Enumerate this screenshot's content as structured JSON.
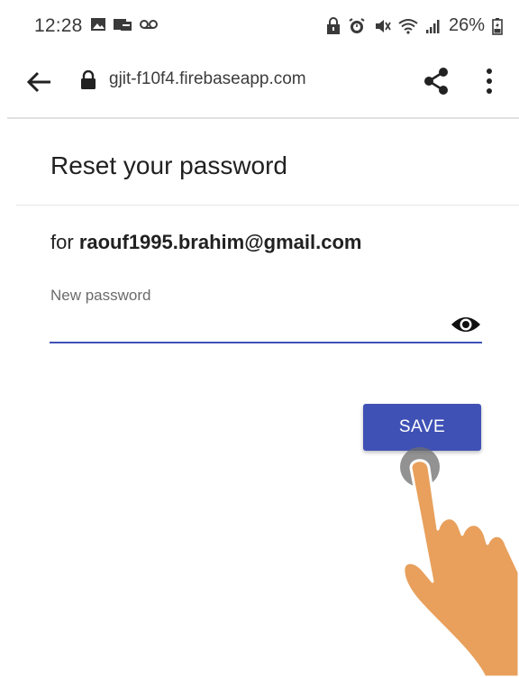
{
  "status_bar": {
    "time": "12:28",
    "battery_percent": "26%",
    "left_icons": [
      "image-icon",
      "sim-icon",
      "voicemail-icon"
    ],
    "right_icons": [
      "lock-notification-icon",
      "alarm-icon",
      "mute-icon",
      "wifi-icon",
      "signal-icon",
      "battery-icon"
    ]
  },
  "browser": {
    "url": "gjit-f10f4.firebaseapp.com",
    "icons": [
      "back-arrow-icon",
      "lock-icon",
      "share-icon",
      "more-vert-icon"
    ]
  },
  "page": {
    "title": "Reset your password",
    "for_prefix": "for",
    "email": "raouf1995.brahim@gmail.com",
    "password_field": {
      "label": "New password",
      "value": ""
    },
    "save_label": "SAVE"
  },
  "colors": {
    "accent": "#3f51b5",
    "hand": "#e8a05c",
    "tap": "#6e6e6e"
  }
}
